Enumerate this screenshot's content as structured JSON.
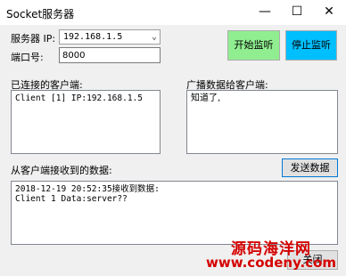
{
  "window": {
    "title": "Socket服务器",
    "minimize_glyph": "—",
    "maximize_glyph": "☐",
    "close_glyph": "✕"
  },
  "server": {
    "ip_label": "服务器 IP:",
    "ip_value": "192.168.1.5",
    "port_label": "端口号:",
    "port_value": "8000"
  },
  "buttons": {
    "start": "开始监听",
    "stop": "停止监听",
    "send": "发送数据",
    "close": "关闭"
  },
  "colors": {
    "start_bg": "#90ee90",
    "stop_bg": "#00bfff"
  },
  "clients": {
    "label": "已连接的客户端:",
    "items": [
      "Client [1] IP:192.168.1.5"
    ]
  },
  "broadcast": {
    "label": "广播数据给客户端:",
    "text": "知道了,"
  },
  "received": {
    "label": "从客户端接收到的数据:",
    "lines": [
      "2018-12-19 20:52:35接收到数据:",
      "Client 1 Data:server??"
    ]
  },
  "watermark": {
    "title": "源码海洋网",
    "url": "www.codeny.com"
  }
}
